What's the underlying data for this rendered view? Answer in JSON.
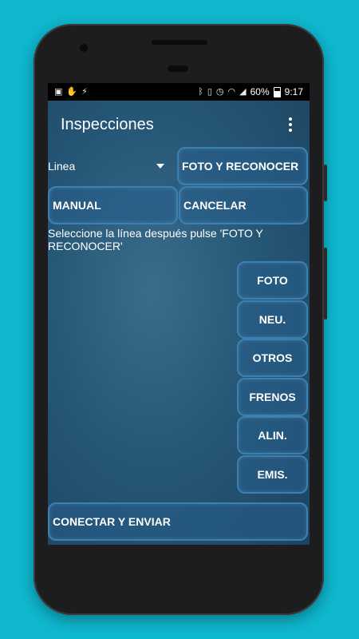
{
  "status_bar": {
    "battery_percent": "60%",
    "time": "9:17",
    "icons": [
      "gallery-icon",
      "hand-icon",
      "flashlight-icon",
      "bluetooth-icon",
      "vibrate-icon",
      "alarm-icon",
      "wifi-icon",
      "signal-icon",
      "battery-icon"
    ]
  },
  "app_bar": {
    "title": "Inspecciones",
    "menu_icon": "overflow-menu-icon"
  },
  "form": {
    "line_spinner_value": "Linea",
    "photo_recognize_label": "FOTO Y RECONOCER",
    "manual_label": "MANUAL",
    "cancel_label": "CANCELAR",
    "hint": "Seleccione la línea después pulse 'FOTO Y RECONOCER'"
  },
  "side_buttons": [
    "FOTO",
    "NEU.",
    "OTROS",
    "FRENOS",
    "ALIN.",
    "EMIS."
  ],
  "bottom": {
    "connect_send_label": "CONECTAR Y ENVIAR"
  }
}
